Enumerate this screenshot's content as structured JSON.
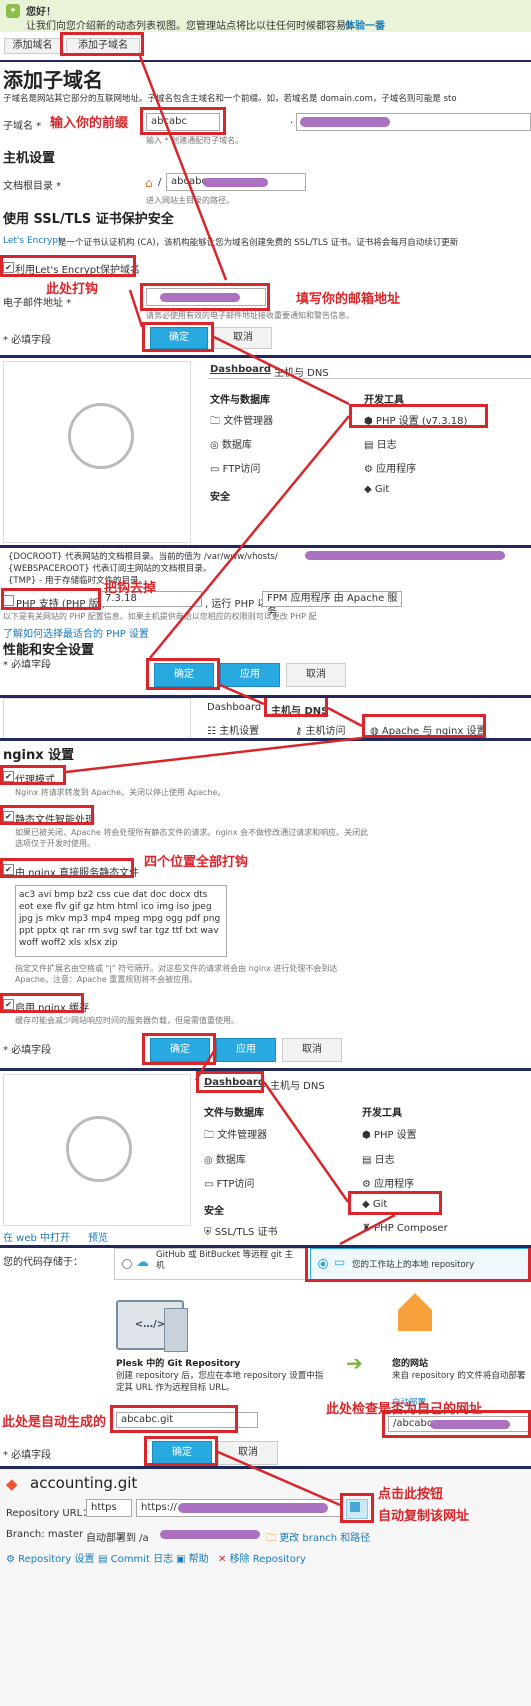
{
  "banner": {
    "title": "您好！",
    "text": "让我们向您介绍新的动态列表视图。您管理站点将比以往任何时候都容易！",
    "link": "体验一番"
  },
  "tabs": {
    "add_domain": "添加域名",
    "add_subdomain": "添加子域名"
  },
  "section1": {
    "title": "添加子域名",
    "desc": "子域名是网站其它部分的互联网地址。子域名包含主域名和一个前缀。如，若域名是 domain.com，子域名则可能是 sto",
    "subdomain_label": "子域名 *",
    "subdomain_value": "abcabc",
    "subdomain_hint": "输入 * 创建通配符子域名。",
    "dot": ".",
    "host_title": "主机设置",
    "docroot_label": "文档根目录 *",
    "docroot_value": "abcabc",
    "docroot_hint": "进入网站主目录的路径。",
    "ssl_title": "使用 SSL/TLS 证书保护安全",
    "ssl_desc_link": "Let's Encrypt",
    "ssl_desc": " 是一个证书认证机构 (CA)，该机构能够让您为域名创建免费的 SSL/TLS 证书。证书将会每月自动续订更新",
    "ssl_checkbox": "利用Let's Encrypt保护域名",
    "email_label": "电子邮件地址 *",
    "email_hint": "请务必使用有效的电子邮件地址接收重要通知和警告信息。",
    "required": "* 必填字段",
    "ok": "确定",
    "cancel": "取消"
  },
  "annotations": {
    "a1": "输入你的前缀",
    "a2": "此处打钩",
    "a3": "填写你的邮箱地址",
    "a4": "把钩去掉",
    "a5": "四个位置全部打钩",
    "a6": "此处是自动生成的",
    "a7": "此处检查是否为自己的网址",
    "a8": "点击此按钮",
    "a9": "自动复制该网址"
  },
  "dashboard1": {
    "tab_dashboard": "Dashboard",
    "tab_hosting": "主机与 DNS",
    "files_title": "文件与数据库",
    "file_manager": "文件管理器",
    "databases": "数据库",
    "ftp": "FTP访问",
    "security": "安全",
    "dev_title": "开发工具",
    "php": "PHP 设置 (v7.3.18)",
    "logs": "日志",
    "apps": "应用程序",
    "git": "Git"
  },
  "php": {
    "line1": "{DOCROOT} 代表网站的文档根目录。当前的值为 /var/www/vhosts/",
    "line2": "{WEBSPACEROOT} 代表订阅主网站的文档根目录。",
    "line3": "{TMP} - 用于存储临时文件的目录。",
    "php_label": "PHP 支持 (PHP 版本",
    "php_version": "7.3.18",
    "run_as": ", 运行 PHP 以",
    "handler": "FPM 应用程序 由 Apache 服务",
    "note": "以下是有关网站的 PHP 配置信息。如果主机提供商给以您相应的权限则可以更改 PHP 配",
    "learn": "了解如何选择最适合的 PHP 设置",
    "perf_title": "性能和安全设置",
    "required": "* 必填字段",
    "ok": "确定",
    "apply": "应用",
    "cancel": "取消"
  },
  "hosting": {
    "tab_dashboard": "Dashboard",
    "tab_hosting": "主机与 DNS",
    "host_settings": "主机设置",
    "host_access": "主机访问",
    "apache_nginx": "Apache 与 nginx 设置"
  },
  "nginx": {
    "title": "nginx 设置",
    "proxy": "代理模式",
    "proxy_hint": "Nginx 将请求转发到 Apache。关闭以停止使用 Apache。",
    "smart_static": "静态文件智能处理",
    "smart_hint": "如果已被关闭，Apache 将会处理所有静态文件的请求。nginx 会不做修改通过请求和响应。关闭此选项仅于开发时使用。",
    "serve_static": "由 nginx 直接服务静态文件",
    "extensions": "ac3 avi bmp bz2 css cue dat doc docx dts eot exe flv gif gz htm html ico img iso jpeg jpg js mkv mp3 mp4 mpeg mpg ogg pdf png ppt pptx qt rar rm svg swf tar tgz ttf txt wav woff woff2 xls xlsx zip",
    "ext_hint": "指定文件扩展名由空格或 \"|\" 符号隔开。对这些文件的请求将会由 nginx 进行处理不会到达 Apache。注意：Apache 重置规则将不会被应用。",
    "cache": "启用 nginx 缓存",
    "cache_hint": "缓存可能会减少网站响应时间的服务器负载，但是需值重使用。",
    "required": "* 必填字段",
    "ok": "确定",
    "apply": "应用",
    "cancel": "取消"
  },
  "dashboard2": {
    "tab_dashboard": "Dashboard",
    "tab_hosting": "主机与 DNS",
    "files_title": "文件与数据库",
    "file_manager": "文件管理器",
    "databases": "数据库",
    "ftp": "FTP访问",
    "security": "安全",
    "ssl": "SSL/TLS 证书",
    "dev_title": "开发工具",
    "php": "PHP 设置",
    "logs": "日志",
    "apps": "应用程序",
    "git": "Git",
    "composer": "PHP Composer",
    "open_web": "在 web 中打开",
    "preview": "预览"
  },
  "git": {
    "repo_label": "您的代码存储于：",
    "remote": "GitHub 或 BitBucket 等远程 git 主机",
    "local": "您的工作站上的本地 repository",
    "plesk_title": "Plesk 中的 Git Repository",
    "plesk_desc": "创建 repository 后，您应在本地 repository 设置中指定其 URL 作为远程目标 URL。",
    "site_title": "您的网站",
    "site_desc": "来自 repository 的文件将自动部署",
    "site_link": "自动部署",
    "repo_name": "abcabc.git",
    "deploy_path": "/abcabc.",
    "required": "* 必填字段",
    "ok": "确定",
    "cancel": "取消"
  },
  "repo": {
    "name": "accounting.git",
    "url_label": "Repository URL：",
    "protocol": "https",
    "url": "https://",
    "branch_label": "Branch: master",
    "auto_deploy": "自动部署到 /a",
    "change": "更改 branch 和路径",
    "settings": "Repository 设置",
    "commits": "Commit 日志",
    "help": "帮助",
    "remove": "移除 Repository"
  },
  "colors": {
    "accent": "#28aae1",
    "annotation": "#d8262b",
    "separator": "#1f2a5a",
    "redacted": "#9b59b6"
  }
}
